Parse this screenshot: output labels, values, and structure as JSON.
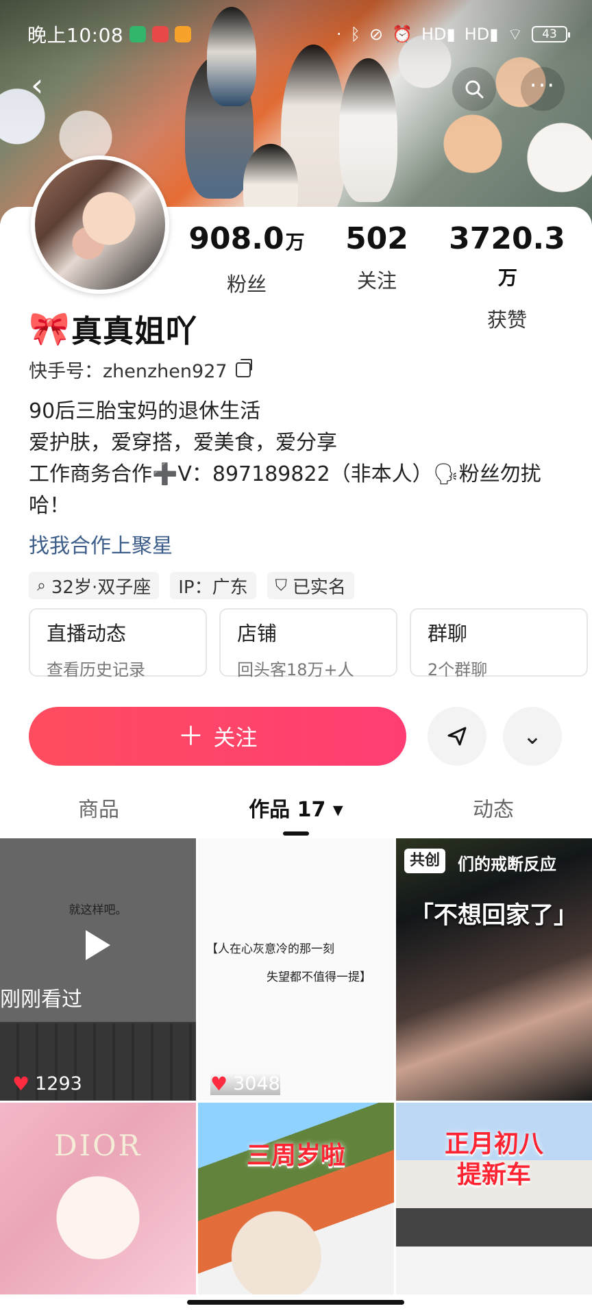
{
  "status": {
    "time": "晚上10:08",
    "battery": "43",
    "signal_hd_1": "HD",
    "signal_hd_2": "HD"
  },
  "profile": {
    "followers_value": "908.0",
    "followers_unit": "万",
    "followers_label": "粉丝",
    "following_value": "502",
    "following_label": "关注",
    "likes_value": "3720.3",
    "likes_unit": "万",
    "likes_label": "获赞",
    "name": "真真姐吖",
    "id": "快手号：zhenzhen927",
    "bio_line_1": "90后三胎宝妈的退休生活",
    "bio_line_2": "爱护肤，爱穿搭，爱美食，爱分享",
    "bio_line_3": "工作商务合作➕V：897189822（非本人）🗣粉丝勿扰",
    "bio_line_4": "哈！",
    "cooperate_link": "找我合作上聚星",
    "tags": [
      "32岁·双子座",
      "IP：广东",
      "已实名"
    ]
  },
  "cards": [
    {
      "title": "直播动态",
      "sub": "查看历史记录"
    },
    {
      "title": "店铺",
      "sub": "回头客18万+人"
    },
    {
      "title": "群聊",
      "sub": "2个群聊"
    }
  ],
  "actions": {
    "follow_label": "关注"
  },
  "tabs": [
    "商品",
    "作品 17",
    "动态"
  ],
  "videos": [
    {
      "top_text": "就这样吧。",
      "label": "刚刚看过",
      "likes": "1293"
    },
    {
      "quote_line_1": "【人在心灰意冷的那一刻",
      "quote_line_2": "失望都不值得一提】",
      "likes": "3048"
    },
    {
      "badge": "共创",
      "caption": "们的戒断反应",
      "overlay": "「不想回家了」"
    },
    {
      "brand": "DIOR"
    },
    {
      "title": "三周岁啦"
    },
    {
      "title_line_1": "正月初八",
      "title_line_2": "提新车"
    }
  ]
}
